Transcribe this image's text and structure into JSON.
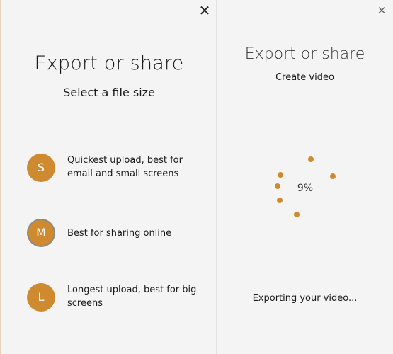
{
  "left_panel": {
    "close_label": "✕",
    "title": "Export or share",
    "subtitle": "Select a file size",
    "options": [
      {
        "badge": "S",
        "text": "Quickest upload, best for email and small screens"
      },
      {
        "badge": "M",
        "text": "Best for sharing online",
        "selected": true
      },
      {
        "badge": "L",
        "text": "Longest upload, best for big screens"
      }
    ]
  },
  "right_panel": {
    "close_label": "✕",
    "title": "Export or share",
    "subtitle": "Create video",
    "progress": {
      "percent_label": "9%",
      "value": 0.09
    },
    "status": "Exporting your video..."
  },
  "colors": {
    "accent": "#cf8a2f",
    "background": "#f4f4f4",
    "text": "#1a1a1a"
  },
  "icons": {
    "close": "close-icon",
    "spinner": "progress-spinner-icon"
  }
}
